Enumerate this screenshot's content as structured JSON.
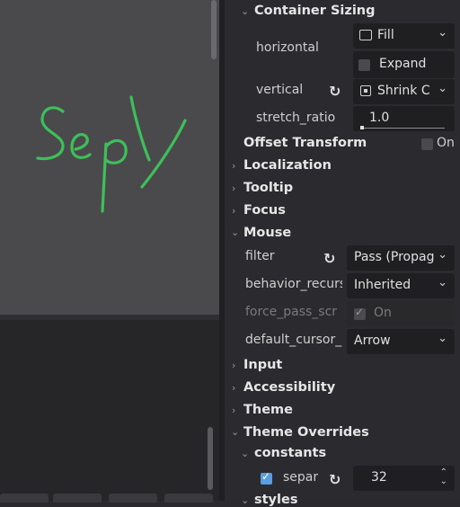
{
  "sections": {
    "container_sizing": "Container Sizing",
    "offset_transform": "Offset Transform",
    "localization": "Localization",
    "tooltip": "Tooltip",
    "focus": "Focus",
    "mouse": "Mouse",
    "input": "Input",
    "accessibility": "Accessibility",
    "theme": "Theme",
    "theme_overrides": "Theme Overrides",
    "constants": "constants",
    "styles": "styles"
  },
  "container_sizing": {
    "horizontal_label": "horizontal",
    "horizontal_value": "Fill",
    "expand_label": "Expand",
    "vertical_label": "vertical",
    "vertical_value": "Shrink C",
    "stretch_label": "stretch_ratio",
    "stretch_value": "1.0"
  },
  "offset_transform": {
    "toggle_label": "On"
  },
  "mouse": {
    "filter_label": "filter",
    "filter_value": "Pass (Propag",
    "behavior_label": "behavior_recurs",
    "behavior_value": "Inherited",
    "force_label": "force_pass_scr",
    "force_value": "On",
    "cursor_label": "default_cursor_",
    "cursor_value": "Arrow"
  },
  "theme_overrides": {
    "separ_label": "separ",
    "separ_value": "32"
  },
  "colors": {
    "accent": "#5b9ee0",
    "drawing_stroke": "#3fbf5a",
    "canvas_bg": "#4a4a4d",
    "inspector_bg": "#2b2b2f"
  }
}
